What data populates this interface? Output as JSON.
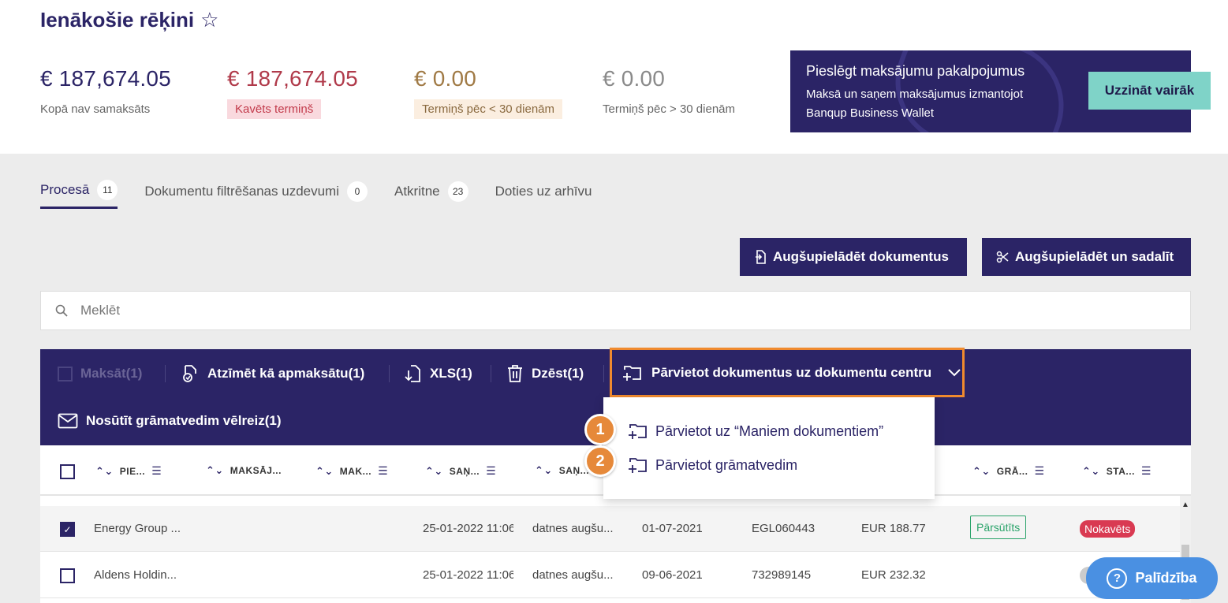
{
  "header": {
    "title": "Ienākošie rēķini",
    "stats": [
      {
        "amount": "€ 187,674.05",
        "label": "Kopā nav samaksāts",
        "color": "#2b2466"
      },
      {
        "amount": "€ 187,674.05",
        "label": "Kavēts termiņš",
        "color": "#b03a4a"
      },
      {
        "amount": "€ 0.00",
        "label": "Termiņš pēc < 30 dienām",
        "color": "#a07a45"
      },
      {
        "amount": "€ 0.00",
        "label": "Termiņš pēc > 30 dienām",
        "color": "#8a8a8a"
      }
    ]
  },
  "promo": {
    "title": "Pieslēgt maksājumu pakalpojumus",
    "subtitle": "Maksā un saņem maksājumus izmantojot Banqup Business Wallet",
    "button": "Uzzināt vairāk"
  },
  "tabs": [
    {
      "label": "Procesā",
      "count": "11"
    },
    {
      "label": "Dokumentu filtrēšanas uzdevumi",
      "count": "0"
    },
    {
      "label": "Atkritne",
      "count": "23"
    },
    {
      "label": "Doties uz arhīvu",
      "count": ""
    }
  ],
  "actions": {
    "upload": "Augšupielādēt dokumentus",
    "upload_split": "Augšupielādēt un sadalīt"
  },
  "search": {
    "placeholder": "Meklēt"
  },
  "toolbar": {
    "pay": "Maksāt(1)",
    "mark_paid": "Atzīmēt kā apmaksātu(1)",
    "xls": "XLS(1)",
    "delete": "Dzēst(1)",
    "move": "Pārvietot dokumentus uz dokumentu centru",
    "resend": "Nosūtīt grāmatvedim vēlreiz(1)"
  },
  "dropdown": {
    "items": [
      {
        "num": "1",
        "label": "Pārvietot uz “Maniem dokumentiem”"
      },
      {
        "num": "2",
        "label": "Pārvietot grāmatvedim"
      }
    ]
  },
  "table": {
    "columns": [
      "PIE...",
      "MAKSĀJ...",
      "MAK...",
      "SAŅ...",
      "SAŅ...",
      "GRĀ...",
      "STA..."
    ],
    "rows": [
      {
        "supplier": "Energy Group ...",
        "received": "25-01-2022 11:06",
        "source": "datnes augšu...",
        "date": "01-07-2021",
        "number": "EGL060443",
        "amount": "EUR 188.77",
        "accountant": "Pārsūtīts",
        "status": "Nokavēts",
        "checked": true
      },
      {
        "supplier": "Aldens Holdin...",
        "received": "25-01-2022 11:06",
        "source": "datnes augšu...",
        "date": "09-06-2021",
        "number": "732989145",
        "amount": "EUR 232.32",
        "accountant": "",
        "status": "",
        "checked": false
      }
    ]
  },
  "help": {
    "label": "Palīdzība"
  }
}
